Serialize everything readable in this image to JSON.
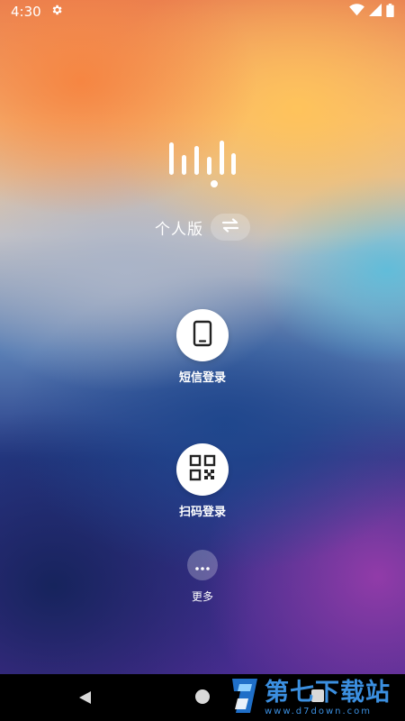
{
  "status_bar": {
    "time": "4:30"
  },
  "edition": {
    "label": "个人版"
  },
  "actions": {
    "sms_login": "短信登录",
    "scan_login": "扫码登录",
    "more": "更多"
  },
  "watermark": {
    "title": "第七下载站",
    "url": "www.d7down.com"
  },
  "colors": {
    "brand_watermark": "#3b8fe0",
    "nav_bar": "#000000"
  }
}
